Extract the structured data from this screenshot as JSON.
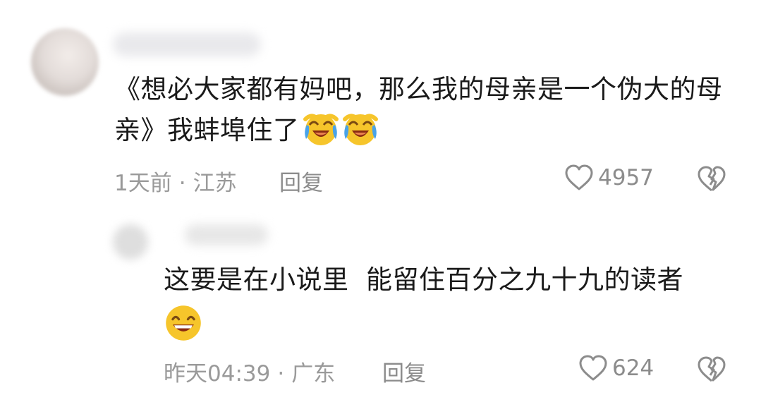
{
  "comment": {
    "text": "《想必大家都有妈吧，那么我的母亲是一个伪大的母亲》我蚌埠住了",
    "time": "1天前",
    "location": "江苏",
    "separator": "·",
    "reply_label": "回复",
    "likes": "4957",
    "emoji_names": [
      "laugh-cry-emoji",
      "laugh-cry-emoji"
    ]
  },
  "reply": {
    "text": "这要是在小说里  能留住百分之九十九的读者",
    "time": "昨天04:39",
    "location": "广东",
    "separator": "·",
    "reply_label": "回复",
    "likes": "624",
    "emoji_names": [
      "grin-emoji"
    ]
  },
  "icons": {
    "like": "heart-outline-icon",
    "dislike": "broken-heart-icon"
  },
  "colors": {
    "text": "#1a1a1a",
    "meta": "#9a9a9a",
    "emoji_yellow": "#f6c52b",
    "emoji_blue": "#4aa3e8"
  }
}
